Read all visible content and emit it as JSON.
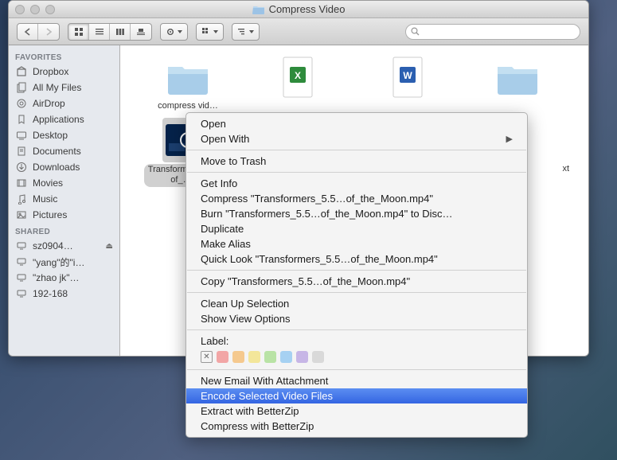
{
  "window": {
    "title": "Compress Video"
  },
  "search": {
    "placeholder": ""
  },
  "sidebar": {
    "sections": [
      {
        "header": "FAVORITES",
        "items": [
          {
            "label": "Dropbox",
            "icon": "box-icon"
          },
          {
            "label": "All My Files",
            "icon": "allfiles-icon"
          },
          {
            "label": "AirDrop",
            "icon": "airdrop-icon"
          },
          {
            "label": "Applications",
            "icon": "applications-icon"
          },
          {
            "label": "Desktop",
            "icon": "desktop-icon"
          },
          {
            "label": "Documents",
            "icon": "documents-icon"
          },
          {
            "label": "Downloads",
            "icon": "downloads-icon"
          },
          {
            "label": "Movies",
            "icon": "movies-icon"
          },
          {
            "label": "Music",
            "icon": "music-icon"
          },
          {
            "label": "Pictures",
            "icon": "pictures-icon"
          }
        ]
      },
      {
        "header": "SHARED",
        "items": [
          {
            "label": "sz0904…",
            "icon": "computer-icon",
            "eject": true
          },
          {
            "label": "\"yang\"的\"i…",
            "icon": "computer-icon"
          },
          {
            "label": "\"zhao jk\"…",
            "icon": "computer-icon"
          },
          {
            "label": "192-168",
            "icon": "computer-icon"
          }
        ]
      }
    ]
  },
  "files": [
    {
      "label": "compress vid…",
      "type": "folder"
    },
    {
      "label": "",
      "type": "xls"
    },
    {
      "label": "",
      "type": "doc"
    },
    {
      "label": "",
      "type": "folder"
    },
    {
      "label": "Transformers_Dark_of_…d…",
      "type": "video",
      "selected": true
    },
    {
      "label": "",
      "type": "blank"
    },
    {
      "label": "",
      "type": "blank"
    },
    {
      "label": "xt",
      "type": "blank-corner"
    }
  ],
  "context_menu": {
    "groups": [
      [
        {
          "label": "Open"
        },
        {
          "label": "Open With",
          "submenu": true
        }
      ],
      [
        {
          "label": "Move to Trash"
        }
      ],
      [
        {
          "label": "Get Info"
        },
        {
          "label": "Compress \"Transformers_5.5…of_the_Moon.mp4\""
        },
        {
          "label": "Burn \"Transformers_5.5…of_the_Moon.mp4\" to Disc…"
        },
        {
          "label": "Duplicate"
        },
        {
          "label": "Make Alias"
        },
        {
          "label": "Quick Look \"Transformers_5.5…of_the_Moon.mp4\""
        }
      ],
      [
        {
          "label": "Copy \"Transformers_5.5…of_the_Moon.mp4\""
        }
      ],
      [
        {
          "label": "Clean Up Selection"
        },
        {
          "label": "Show View Options"
        }
      ]
    ],
    "label_header": "Label:",
    "label_colors": [
      "#f2a6a6",
      "#f5c98e",
      "#f3e69a",
      "#b9e3a5",
      "#a6d1f2",
      "#c7b6e6",
      "#d9d9d9"
    ],
    "services": [
      {
        "label": "New Email With Attachment"
      },
      {
        "label": "Encode Selected Video Files",
        "highlight": true
      },
      {
        "label": "Extract with BetterZip"
      },
      {
        "label": "Compress with BetterZip"
      }
    ]
  }
}
